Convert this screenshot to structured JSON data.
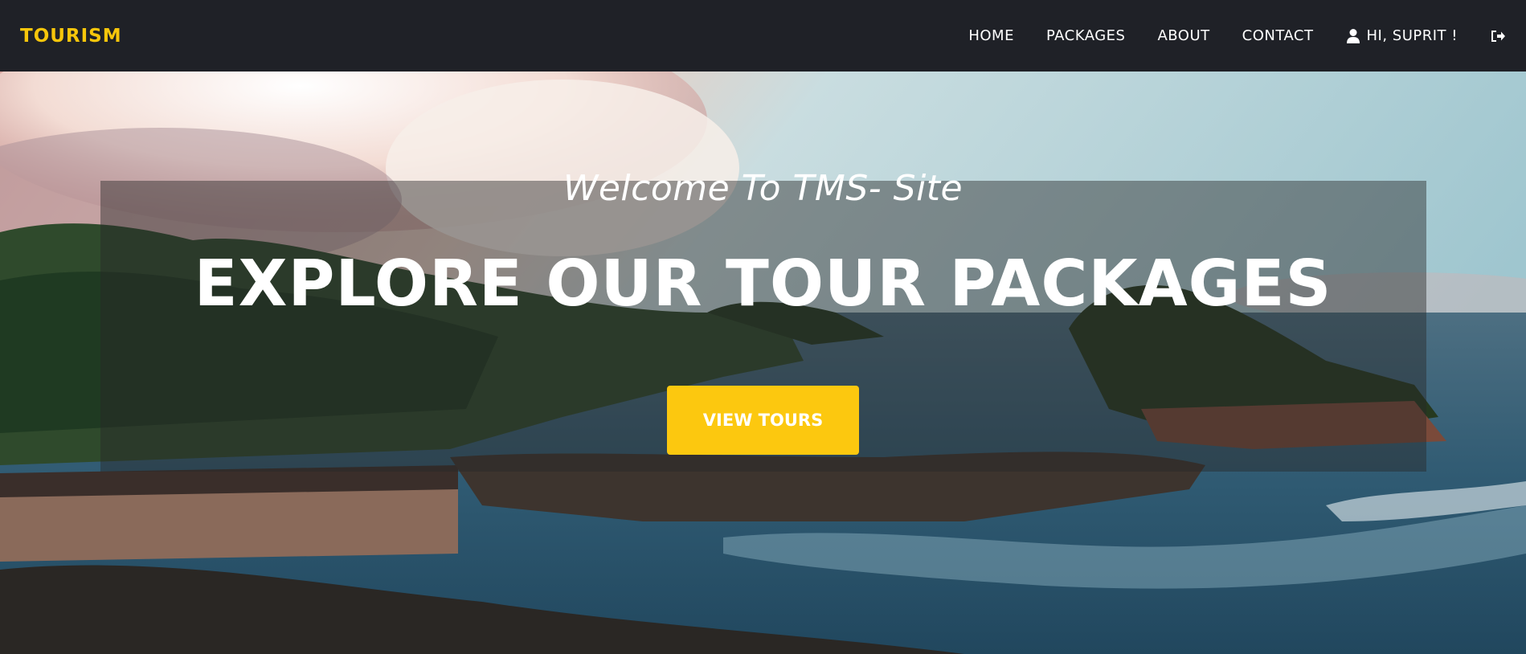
{
  "brand": {
    "name": "TOURISM",
    "color": "#f7c60b"
  },
  "nav": {
    "items": [
      {
        "label": "HOME"
      },
      {
        "label": "PACKAGES"
      },
      {
        "label": "ABOUT"
      },
      {
        "label": "CONTACT"
      }
    ],
    "user_greeting": "HI, SUPRIT !",
    "user_icon": "user-icon",
    "logout_icon": "sign-out-icon"
  },
  "hero": {
    "welcome_text": "Welcome To TMS- Site",
    "headline": "EXPLORE OUR TOUR PACKAGES",
    "cta_label": "VIEW TOURS",
    "cta_color": "#fcc80f"
  },
  "theme": {
    "navbar_bg": "#1f2127",
    "text": "#ffffff"
  }
}
